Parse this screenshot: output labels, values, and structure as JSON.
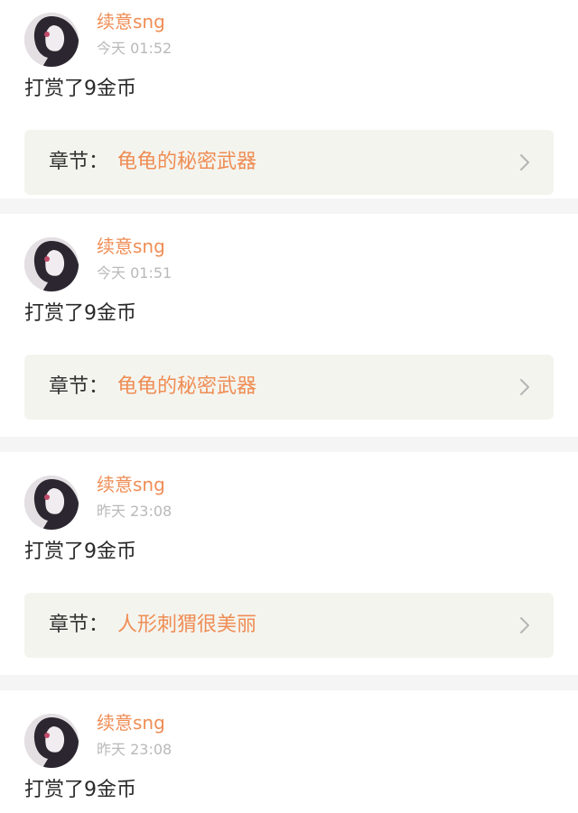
{
  "items": [
    {
      "username": "续意sng",
      "time": "今天 01:52",
      "action": "打赏了9金币",
      "chapter_label": "章节：",
      "chapter_title": "龟龟的秘密武器"
    },
    {
      "username": "续意sng",
      "time": "今天 01:51",
      "action": "打赏了9金币",
      "chapter_label": "章节：",
      "chapter_title": "龟龟的秘密武器"
    },
    {
      "username": "续意sng",
      "time": "昨天 23:08",
      "action": "打赏了9金币",
      "chapter_label": "章节：",
      "chapter_title": "人形刺猬很美丽"
    },
    {
      "username": "续意sng",
      "time": "昨天 23:08",
      "action": "打赏了9金币"
    }
  ],
  "colors": {
    "accent": "#ef8d55",
    "timestamp": "#b9b9b9",
    "card_bg": "#ffffff",
    "chapter_bg": "#f4f4ee",
    "divider_bg": "#f5f5f5"
  },
  "icons": {
    "chevron": "chevron-right-icon",
    "avatar": "avatar-image"
  }
}
